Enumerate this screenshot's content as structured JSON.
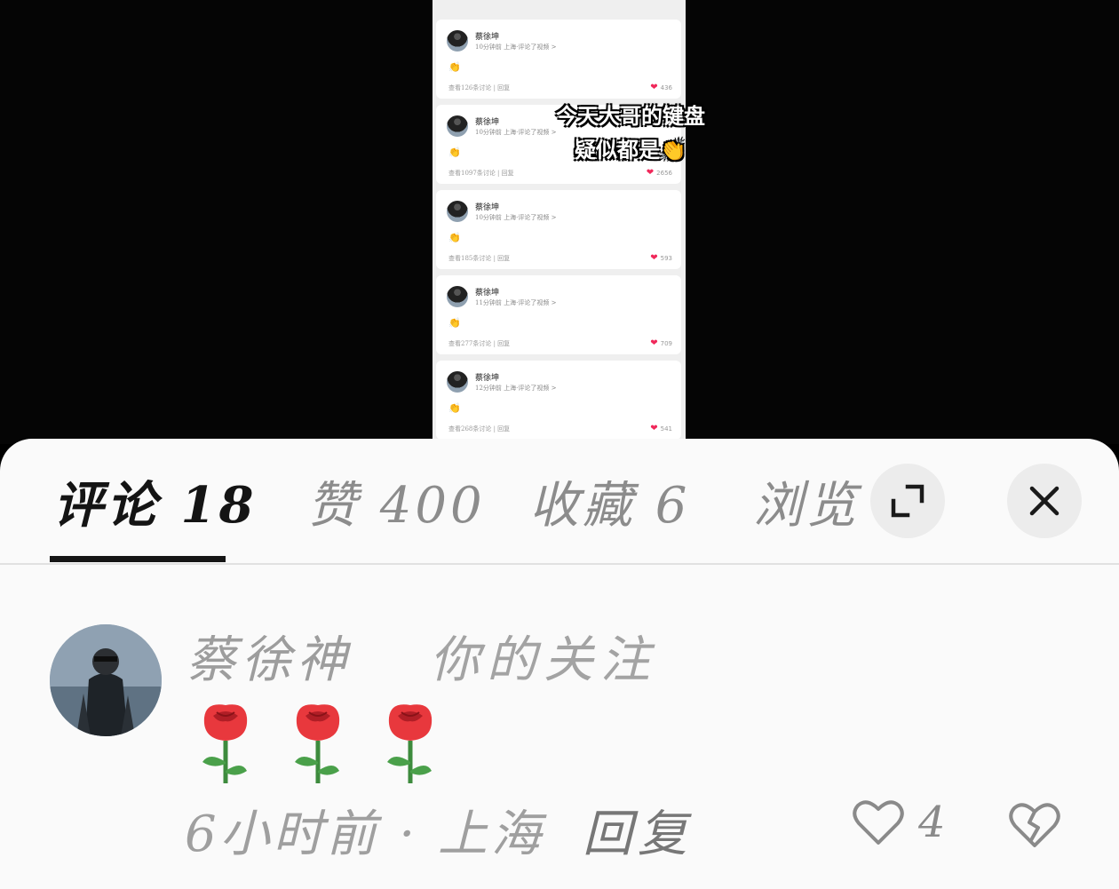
{
  "video": {
    "overlay_caption_line1": "今天大哥的键盘",
    "overlay_caption_line2": "疑似都是👏",
    "cards": [
      {
        "name": "蔡徐坤",
        "meta": "10分钟前 上海·评论了视频 >",
        "emoji": "👏",
        "footer": "查看126条讨论 | 回复",
        "likes": "436"
      },
      {
        "name": "蔡徐坤",
        "meta": "10分钟前 上海·评论了视频 >",
        "emoji": "👏",
        "footer": "查看1097条讨论 | 回复",
        "likes": "2656"
      },
      {
        "name": "蔡徐坤",
        "meta": "10分钟前 上海·评论了视频 >",
        "emoji": "👏",
        "footer": "查看185条讨论 | 回复",
        "likes": "593"
      },
      {
        "name": "蔡徐坤",
        "meta": "11分钟前 上海·评论了视频 >",
        "emoji": "👏",
        "footer": "查看277条讨论 | 回复",
        "likes": "709"
      },
      {
        "name": "蔡徐坤",
        "meta": "12分钟前 上海·评论了视频 >",
        "emoji": "👏",
        "footer": "查看268条讨论 | 回复",
        "likes": "541"
      }
    ]
  },
  "sheet": {
    "tabs": [
      {
        "label": "评论 18",
        "active": true
      },
      {
        "label": "赞 400",
        "active": false
      },
      {
        "label": "收藏 6",
        "active": false
      },
      {
        "label": "浏览",
        "active": false
      }
    ],
    "expand_icon": "expand-icon",
    "close_icon": "close-icon"
  },
  "comment": {
    "username": "蔡徐神",
    "follow_tag": "你的关注",
    "content_emoji": "rose x3",
    "time_location": "6小时前 · 上海",
    "reply_label": "回复",
    "like_count": "4",
    "icons": [
      "heart-outline-icon",
      "broken-heart-icon"
    ]
  }
}
